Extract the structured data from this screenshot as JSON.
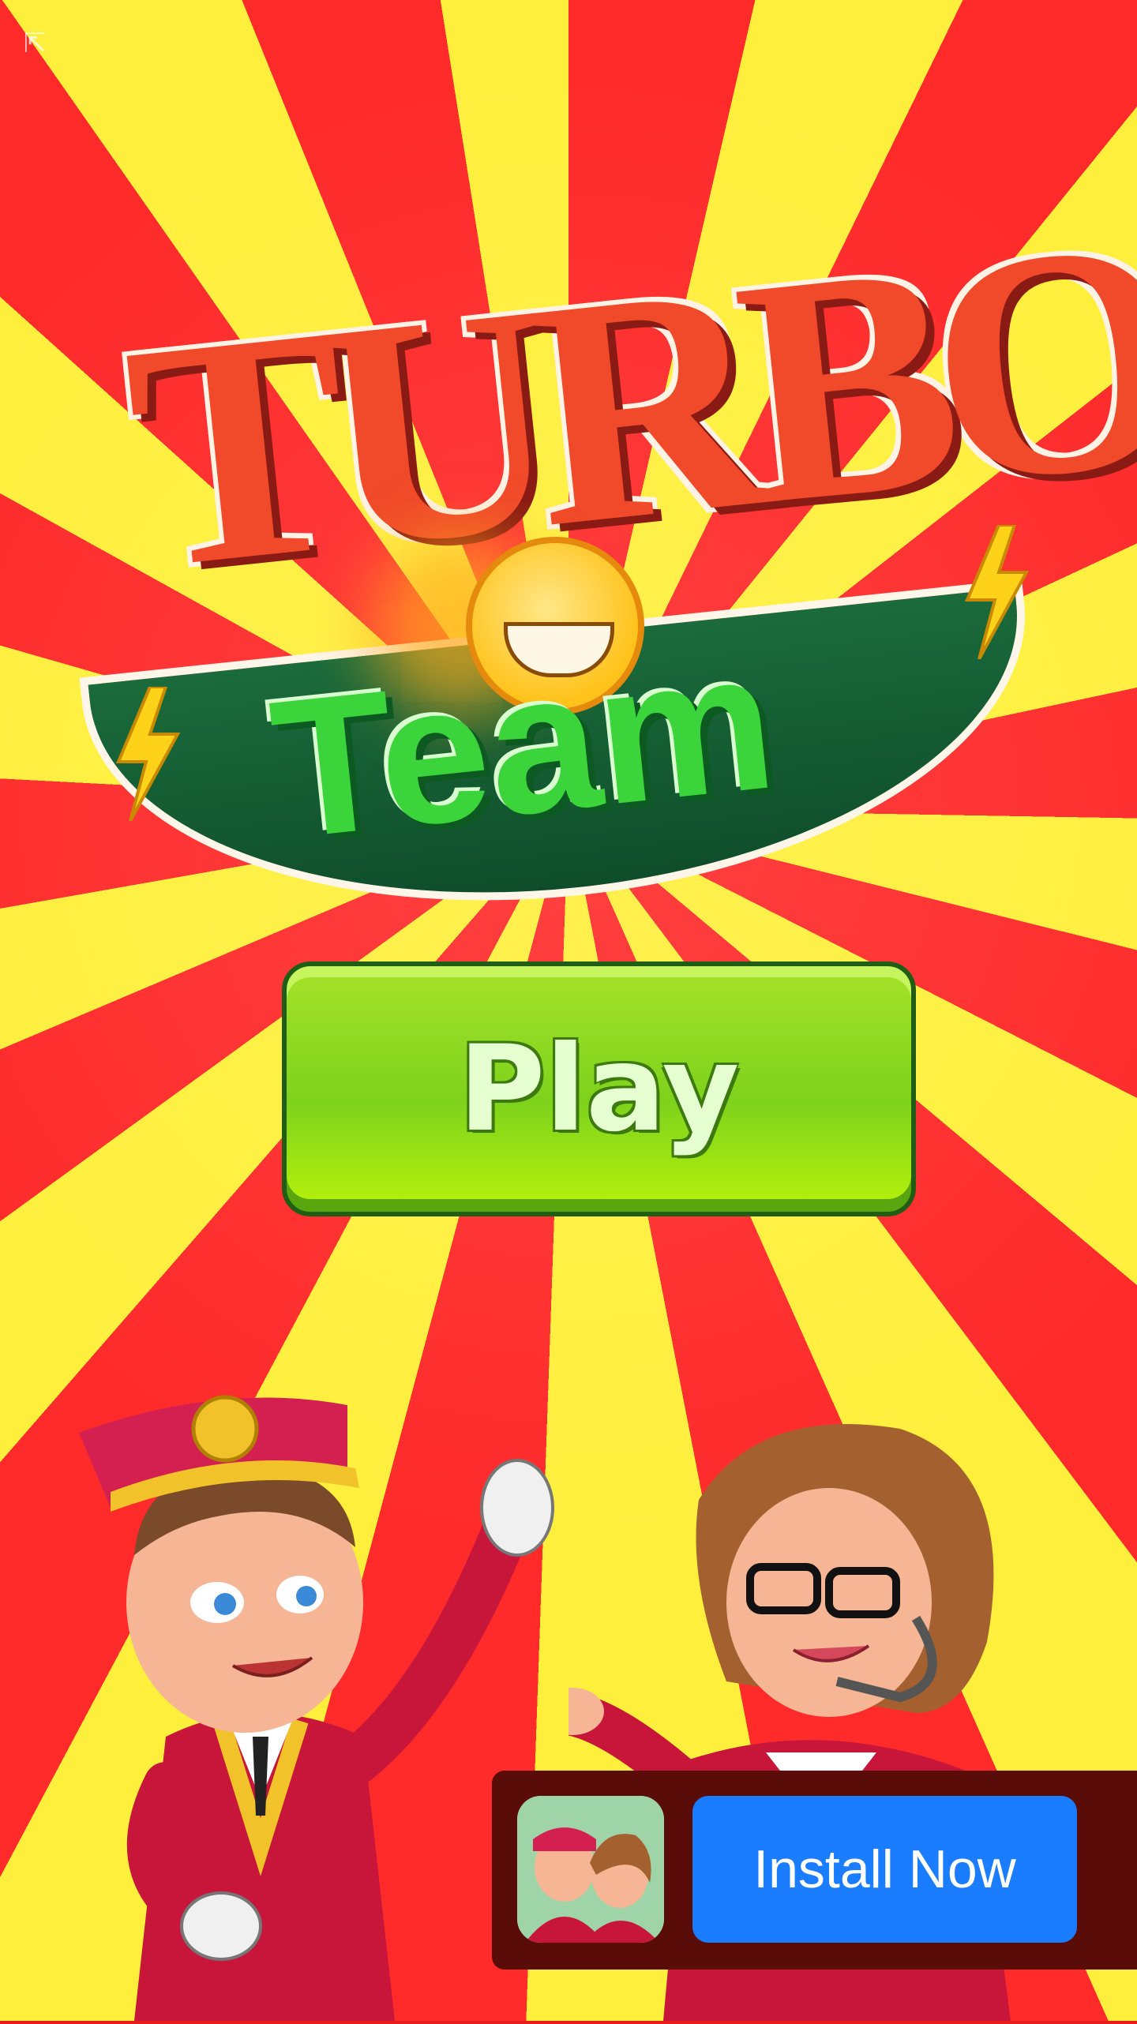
{
  "colors": {
    "ray_red": "#ff2b2b",
    "ray_yellow": "#ffef3d",
    "play_green": "#7ed21c",
    "install_blue": "#1a7cff",
    "banner_bg": "#5a0d08"
  },
  "logo": {
    "line1": "TURBO",
    "line2": "Team"
  },
  "play_button": {
    "label": "Play"
  },
  "install_banner": {
    "button_label": "Install Now",
    "app_icon": "turbo-team-app-icon"
  },
  "corner_icon": {
    "name": "exit-icon"
  }
}
